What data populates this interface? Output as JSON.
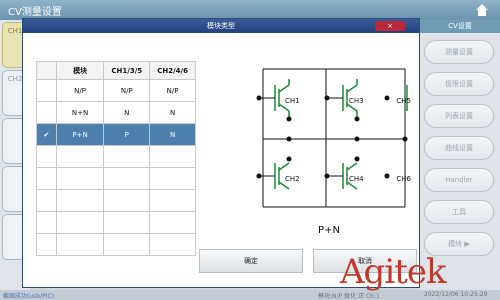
{
  "app": {
    "title": "CV测量设置"
  },
  "left_tabs": [
    {
      "label": "CH1"
    },
    {
      "label": "CH2"
    }
  ],
  "right_menu": {
    "title": "CV设置",
    "items": [
      "测量设置",
      "极限设置",
      "列表设置",
      "曲线设置",
      "Handler",
      "工具",
      "模块 ▶"
    ]
  },
  "dialog": {
    "title": "模块类型",
    "close": "×",
    "table": {
      "headers": [
        "",
        "模块",
        "CH1/3/5",
        "CH2/4/6"
      ],
      "rows": [
        [
          "",
          "N/P",
          "N/P",
          "N/P"
        ],
        [
          "",
          "N+N",
          "N",
          "N"
        ],
        [
          "✔",
          "P+N",
          "P",
          "N"
        ],
        [
          "",
          "",
          "",
          ""
        ],
        [
          "",
          "",
          "",
          ""
        ],
        [
          "",
          "",
          "",
          ""
        ],
        [
          "",
          "",
          "",
          ""
        ],
        [
          "",
          "",
          "",
          ""
        ]
      ]
    },
    "circuit": {
      "labels": [
        "CH1",
        "CH3",
        "CH5",
        "CH2",
        "CH4",
        "CH6"
      ],
      "caption": "P+N"
    },
    "ok_label": "确定",
    "cancel_label": "取消"
  },
  "status": {
    "left": "截图成功(usb/PIC)",
    "middle": "模块:N/P  极化:正  Ch:1",
    "time": "2022/12/06 10:25:29"
  },
  "logo": "Agitek",
  "colors": {
    "accent": "#4d7fad",
    "title_bar": "#22407a",
    "close": "#b8273a",
    "logo": "#c0392b"
  }
}
